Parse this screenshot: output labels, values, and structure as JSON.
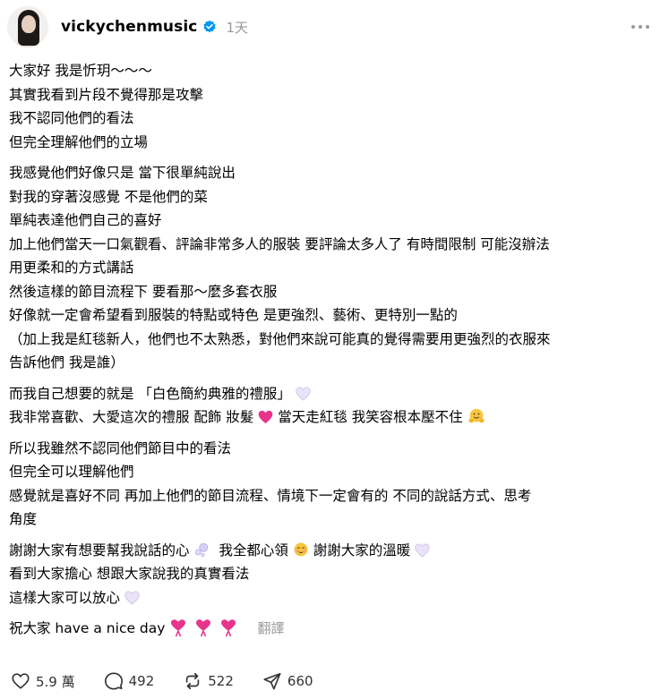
{
  "header": {
    "username": "vickychenmusic",
    "time": "1天"
  },
  "post": {
    "p1": [
      "大家好 我是忻玥～～～",
      "其實我看到片段不覺得那是攻擊",
      "我不認同他們的看法",
      "但完全理解他們的立場"
    ],
    "p2": [
      "我感覺他們好像只是 當下很單純說出",
      "對我的穿著沒感覺 不是他們的菜",
      "單純表達他們自己的喜好",
      "加上他們當天一口氣觀看、評論非常多人的服裝 要評論太多人了 有時間限制 可能沒辦法",
      "用更柔和的方式講話",
      "然後這樣的節目流程下 要看那～麼多套衣服",
      "好像就一定會希望看到服裝的特點或特色 是更強烈、藝術、更特別一點的",
      "（加上我是紅毯新人，他們也不太熟悉，對他們來說可能真的覺得需要用更強烈的衣服來",
      "告訴他們 我是誰）"
    ],
    "p3_line1": "而我自己想要的就是 「白色簡約典雅的禮服」",
    "p3_line2a": "我非常喜歡、大愛這次的禮服 配飾 妝髮",
    "p3_line2b": "當天走紅毯 我笑容根本壓不住",
    "p4": [
      "所以我雖然不認同他們節目中的看法",
      "但完全可以理解他們",
      "感覺就是喜好不同 再加上他們的節目流程、情境下一定會有的 不同的說話方式、思考",
      "角度"
    ],
    "p5_line1a": "謝謝大家有想要幫我說話的心",
    "p5_line1b": "我全都心領",
    "p5_line1c": "謝謝大家的溫暖",
    "p5_line2": "看到大家擔心 想跟大家說我的真實看法",
    "p5_line3": "這樣大家可以放心",
    "last": "祝大家 have a nice day",
    "translate": "翻譯"
  },
  "actions": {
    "likes": "5.9 萬",
    "comments": "492",
    "reposts": "522",
    "shares": "660"
  },
  "icons": {
    "verified": "verified-badge-icon",
    "more": "more-options-icon",
    "heart_white": "white-heart-icon",
    "heart_pink": "pink-heart-icon",
    "hug": "hugging-face-icon",
    "bubbles": "bubbles-icon",
    "relieved": "relieved-face-icon",
    "ribbon_heart": "heart-with-ribbon-icon",
    "like": "heart-icon",
    "comment": "comment-icon",
    "repost": "repost-icon",
    "share": "share-icon"
  },
  "colors": {
    "verified": "#0095f6",
    "muted": "#999999",
    "pink": "#e8348b",
    "white_heart": "#d9d0f2"
  }
}
